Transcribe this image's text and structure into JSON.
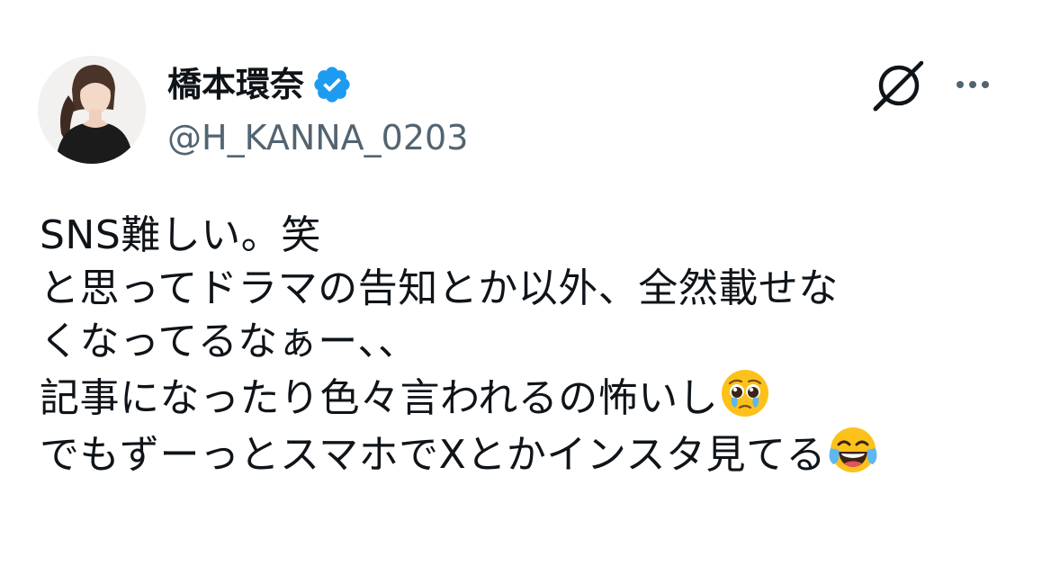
{
  "author": {
    "display_name": "橋本環奈",
    "handle": "@H_KANNA_0203",
    "verified": true,
    "verified_color": "#1d9bf0"
  },
  "actions": {
    "grok_icon": "grok-icon",
    "more_icon": "more-horizontal-icon"
  },
  "tweet": {
    "lines": [
      "SNS難しい。笑",
      "と思ってドラマの告知とか以外、全然載せな",
      "くなってるなぁー、、",
      "記事になったり色々言われるの怖いし",
      "でもずーっとスマホでXとかインスタ見てる"
    ],
    "emojis": {
      "line4": "pleading-face-with-tears-emoji",
      "line5": "face-with-tears-of-joy-emoji"
    }
  },
  "colors": {
    "text": "#0f1419",
    "secondary": "#536471",
    "accent": "#1d9bf0"
  }
}
